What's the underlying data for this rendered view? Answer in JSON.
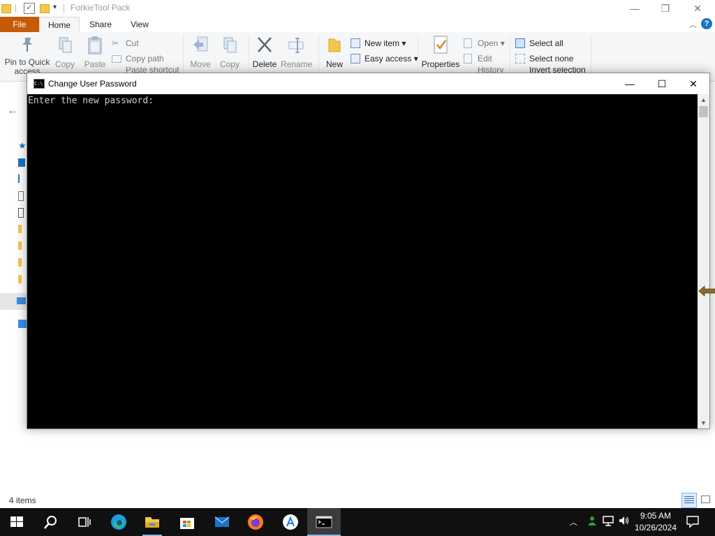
{
  "explorer": {
    "title": "ForkieTool Pack",
    "tabs": {
      "file": "File",
      "home": "Home",
      "share": "Share",
      "view": "View"
    },
    "ribbon": {
      "pin_line1": "Pin to Quick",
      "pin_line2": "access",
      "copy": "Copy",
      "paste": "Paste",
      "cut": "Cut",
      "copy_path": "Copy path",
      "paste_shortcut": "Paste shortcut",
      "move_to": "Move",
      "copy_to": "Copy",
      "delete": "Delete",
      "rename": "Rename",
      "new_folder": "New",
      "new_item": "New item",
      "easy_access": "Easy access",
      "properties": "Properties",
      "open": "Open",
      "edit": "Edit",
      "history": "History",
      "select_all": "Select all",
      "select_none": "Select none",
      "invert_selection": "Invert selection"
    },
    "status": "4 items"
  },
  "cmd": {
    "title": "Change User Password",
    "prompt": "Enter the new password:"
  },
  "taskbar": {
    "time": "9:05 AM",
    "date": "10/26/2024",
    "apps": [
      "start-icon",
      "search-icon",
      "task-view-icon",
      "edge-icon",
      "file-explorer-icon",
      "store-icon",
      "mail-icon",
      "firefox-icon",
      "app-store-icon",
      "terminal-icon"
    ]
  },
  "colors": {
    "file_tab": "#c55b06",
    "console_bg": "#000000",
    "console_text": "#cccccc",
    "taskbar": "#101010"
  }
}
